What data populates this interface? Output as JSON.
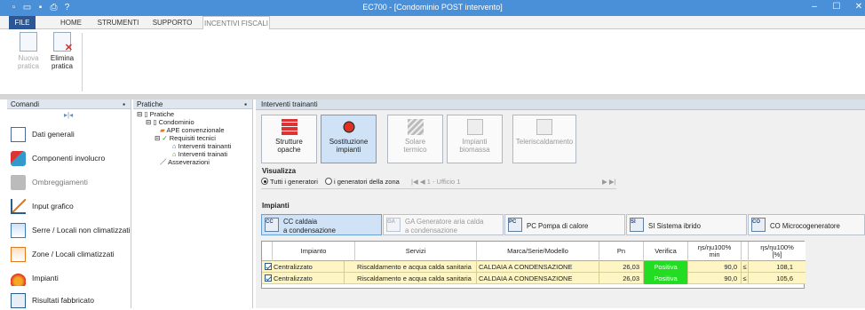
{
  "app": {
    "title": "EC700 - [Condominio POST intervento]",
    "quick_access": [
      "new-icon",
      "open-icon",
      "save-icon",
      "print-icon",
      "help-icon"
    ],
    "window_controls": {
      "minimize": "–",
      "maximize": "☐",
      "close": "✕"
    }
  },
  "ribbon": {
    "tabs": [
      "FILE",
      "HOME",
      "STRUMENTI",
      "SUPPORTO",
      "INCENTIVI FISCALI"
    ],
    "active_tab": "INCENTIVI FISCALI",
    "buttons": [
      {
        "line1": "Nuova",
        "line2": "pratica",
        "icon": "new-document-icon"
      },
      {
        "line1": "Elimina",
        "line2": "pratica",
        "icon": "delete-document-icon"
      }
    ]
  },
  "comandi": {
    "title": "Comandi",
    "pin": "📌",
    "items": [
      {
        "label": "Dati generali",
        "icon": "document-icon"
      },
      {
        "label": "Componenti involucro",
        "icon": "components-icon"
      },
      {
        "label": "Ombreggiamenti",
        "icon": "shading-icon"
      },
      {
        "label": "Input grafico",
        "icon": "graphic-input-icon"
      },
      {
        "label": "Serre / Locali non climatizzati",
        "icon": "greenhouse-icon"
      },
      {
        "label": "Zone / Locali climatizzati",
        "icon": "zones-icon"
      },
      {
        "label": "Impianti",
        "icon": "flame-icon"
      },
      {
        "label": "Risultati fabbricato",
        "icon": "results-icon"
      }
    ]
  },
  "pratiche": {
    "title": "Pratiche",
    "pin": "📌",
    "tree": [
      {
        "label": "Pratiche",
        "level": 0
      },
      {
        "label": "Condominio",
        "level": 1
      },
      {
        "label": "APE convenzionale",
        "level": 2
      },
      {
        "label": "Requisiti tecnici",
        "level": 2
      },
      {
        "label": "Interventi trainanti",
        "level": 3
      },
      {
        "label": "Interventi trainati",
        "level": 3
      },
      {
        "label": "Asseverazioni",
        "level": 2
      }
    ]
  },
  "main": {
    "header": "Interventi trainanti",
    "interventions": [
      {
        "line1": "Strutture",
        "line2": "opache",
        "state": "normal"
      },
      {
        "line1": "Sostituzione",
        "line2": "impianti",
        "state": "selected"
      },
      {
        "line1": "Solare",
        "line2": "termico",
        "state": "disabled"
      },
      {
        "line1": "Impianti",
        "line2": "biomassa",
        "state": "disabled"
      },
      {
        "line1": "Teleriscaldamento",
        "line2": "",
        "state": "disabled"
      }
    ],
    "visualizza": {
      "label": "Visualizza",
      "option_all": "Tutti i generatori",
      "option_zone": "i generatori della zona",
      "zone_value": "1 - Ufficio 1",
      "nav": {
        "first": "|◀",
        "prev": "◀",
        "next": "▶",
        "last": "▶|"
      }
    },
    "impianti": {
      "label": "Impianti",
      "types": [
        {
          "code": "CC",
          "line1": "CC caldaia",
          "line2": "a condensazione",
          "state": "selected"
        },
        {
          "code": "GA",
          "line1": "GA Generatore aria calda",
          "line2": "a condensazione",
          "state": "disabled"
        },
        {
          "code": "PC",
          "line1": "PC Pompa di calore",
          "line2": "",
          "state": "normal"
        },
        {
          "code": "SI",
          "line1": "SI Sistema ibrido",
          "line2": "",
          "state": "normal"
        },
        {
          "code": "CO",
          "line1": "CO Microcogeneratore",
          "line2": "",
          "state": "normal"
        }
      ]
    },
    "table": {
      "headers": [
        "Impianto",
        "Servizi",
        "Marca/Serie/Modello",
        "Pn",
        "Verifica",
        "ηs/ηu100%\nmin",
        "",
        "ηs/ηu100%\n[%]"
      ],
      "rows": [
        {
          "impianto": "Centralizzato",
          "servizi": "Riscaldamento e acqua calda sanitaria",
          "modello": "CALDAIA A CONDENSAZIONE",
          "pn": "26,03",
          "verifica": "Positiva",
          "min": "90,0",
          "op": "≤",
          "pct": "108,1"
        },
        {
          "impianto": "Centralizzato",
          "servizi": "Riscaldamento e acqua calda sanitaria",
          "modello": "CALDAIA A CONDENSAZIONE",
          "pn": "26,03",
          "verifica": "Positiva",
          "min": "90,0",
          "op": "≤",
          "pct": "105,6"
        }
      ]
    }
  },
  "colors": {
    "titlebar": "#4a90d9",
    "positive": "#22dd22",
    "row_bg": "#fdf6c4",
    "selected": "#cfe2f6"
  }
}
